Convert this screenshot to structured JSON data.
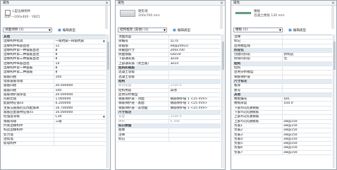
{
  "panels": [
    {
      "id": "p1",
      "title": "属性",
      "type_name": "L型边缘构件",
      "type_sub": "200 ~200x400 - YBZ1",
      "selector": "详图项目 (1)",
      "edit_type": "编辑类型",
      "rows": [
        {
          "k": "其他",
          "v": "",
          "hdr": true
        },
        {
          "k": "边缘构件标高",
          "v": "一级抗震~四级抗震",
          "dd": true
        },
        {
          "k": "边缘构件纵筋直径",
          "v": "12"
        },
        {
          "k": "边缘构件第一种箍筋直径",
          "v": "8"
        },
        {
          "k": "边缘构件第二种箍筋直径",
          "v": "8"
        },
        {
          "k": "边缘构件第三种箍筋直径",
          "v": "8"
        },
        {
          "k": "边缘构件纵筋直径",
          "v": "14"
        },
        {
          "k": "边缘构件第一种箍筋",
          "v": "8"
        },
        {
          "k": "边缘构件第二种箍筋",
          "v": "8"
        },
        {
          "k": "箍筋间距",
          "v": "100"
        },
        {
          "k": "墙肢箍筋等级",
          "v": ""
        },
        {
          "k": "箍筋间距",
          "v": "20.000000"
        },
        {
          "k": "箍筋间距",
          "v": "100"
        },
        {
          "k": "箍筋保护层厚度",
          "v": "20.000000"
        },
        {
          "k": "间距比值",
          "v": "1.000000"
        },
        {
          "k": "配箍特征值λv",
          "v": "0.200000"
        },
        {
          "k": "主筋与箍筋的实际配筋率",
          "v": "16.700000"
        },
        {
          "k": "箍筋区配箍特征值λv",
          "v": "16.000000"
        },
        {
          "k": "砼强度等级",
          "v": "C30",
          "dd": true
        },
        {
          "k": "钢筋等级",
          "v": "三级"
        },
        {
          "k": "约束边缘构件",
          "v": ""
        },
        {
          "k": "构造边缘构件",
          "v": ""
        },
        {
          "k": "剪力墙",
          "v": ""
        },
        {
          "k": "连续墙",
          "v": ""
        },
        {
          "k": "嵌墙构件",
          "v": ""
        }
      ]
    },
    {
      "id": "p2",
      "title": "属性",
      "type_name": "矩形梁",
      "type_sub": "200x700 mm",
      "selector": "结构框架 (其他) (1)",
      "edit_type": "编辑类型",
      "rows": [
        {
          "k": "顶面高度",
          "v": ""
        },
        {
          "k": "梁编号",
          "v": "1L7a"
        },
        {
          "k": "梁箍筋",
          "v": "⌀8@200(2)"
        },
        {
          "k": "梁截面尺寸",
          "v": "200x700"
        },
        {
          "k": "侧面钢筋",
          "v": "G4⌀10"
        },
        {
          "k": "下部通长筋",
          "v": "3⌀18"
        },
        {
          "k": "上部通长筋（架立筋）",
          "v": "3⌀14"
        },
        {
          "k": "结构和钢筋",
          "v": "",
          "hdr": true
        },
        {
          "k": "混凝土等级",
          "v": ""
        },
        {
          "k": "混凝土等级",
          "v": ""
        },
        {
          "k": "结构",
          "v": "",
          "hdr": true
        },
        {
          "k": "剪切长度",
          "v": "2100.0",
          "dim": true
        },
        {
          "k": "结构用途",
          "v": "其他"
        },
        {
          "k": "启用分析模型",
          "v": ""
        },
        {
          "k": "钢筋保护层 - 顶面",
          "v": "钢筋保护层 1 <25 mm>"
        },
        {
          "k": "钢筋保护层 - 底面",
          "v": "钢筋保护层 1 <25 mm>"
        },
        {
          "k": "钢筋保护层 - 其他面",
          "v": "钢筋保护层 1 <25 mm>"
        },
        {
          "k": "尺寸标注",
          "v": "",
          "hdr": true
        },
        {
          "k": "长度",
          "v": "2100.0",
          "dim": true
        },
        {
          "k": "体积",
          "v": "0.308",
          "dim": true
        },
        {
          "k": "标识数据",
          "v": "",
          "hdr": true
        },
        {
          "k": "图像",
          "v": ""
        },
        {
          "k": "注释",
          "v": ""
        },
        {
          "k": "标记",
          "v": ""
        }
      ]
    },
    {
      "id": "p3",
      "title": "属性",
      "type_name": "楼板",
      "type_sub": "混凝土楼板 130 mm",
      "selector": "楼板 (1)",
      "edit_type": "编辑类型",
      "rows": [
        {
          "k": "注释",
          "v": ""
        },
        {
          "k": "标记",
          "v": ""
        },
        {
          "k": "启用模型线",
          "v": ""
        },
        {
          "k": "阶段化",
          "v": "",
          "hdr": true
        },
        {
          "k": "创建的阶段",
          "v": "新构造"
        },
        {
          "k": "拆除的阶段",
          "v": "无"
        },
        {
          "k": "结构",
          "v": "",
          "hdr": true
        },
        {
          "k": "结构",
          "v": ""
        },
        {
          "k": "启用分析模型",
          "v": ""
        },
        {
          "k": "钢筋保护层",
          "v": ""
        },
        {
          "k": "尺寸标注",
          "v": "",
          "hdr": true
        },
        {
          "k": "板厚",
          "v": ""
        },
        {
          "k": "板号",
          "v": ""
        },
        {
          "k": "其他",
          "v": "",
          "hdr": true
        },
        {
          "k": "楼板编号",
          "v": "LB1"
        },
        {
          "k": "楼板厚度",
          "v": "550.0"
        },
        {
          "k": "下部X向贯通钢筋",
          "v": ""
        },
        {
          "k": "下部Y向贯通钢筋",
          "v": ""
        },
        {
          "k": "上部X向贯通钢筋",
          "v": ""
        },
        {
          "k": "上部Y向贯通钢筋",
          "v": "⌀8@150"
        },
        {
          "k": "负筋1",
          "v": "⌀8@150"
        },
        {
          "k": "负筋2",
          "v": "⌀8@150"
        },
        {
          "k": "负筋3",
          "v": "⌀8@150"
        },
        {
          "k": "负筋4",
          "v": "⌀8@150"
        },
        {
          "k": "负筋5",
          "v": "⌀8@150"
        },
        {
          "k": "负筋6",
          "v": "⌀8@150"
        },
        {
          "k": "负筋7",
          "v": "⌀8@150"
        }
      ]
    }
  ]
}
